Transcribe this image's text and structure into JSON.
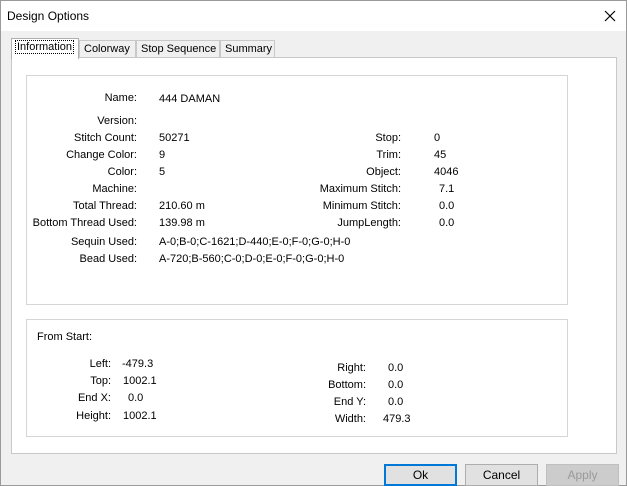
{
  "window": {
    "title": "Design Options"
  },
  "tabs": [
    {
      "label": "Information"
    },
    {
      "label": "Colorway"
    },
    {
      "label": "Stop Sequence"
    },
    {
      "label": "Summary"
    }
  ],
  "info": {
    "name_label": "Name:",
    "name_value": "444 DAMAN",
    "version_label": "Version:",
    "version_value": "",
    "stitch_count_label": "Stitch Count:",
    "stitch_count_value": "50271",
    "change_color_label": "Change Color:",
    "change_color_value": "9",
    "color_label": "Color:",
    "color_value": "5",
    "machine_label": "Machine:",
    "machine_value": "",
    "total_thread_label": "Total Thread:",
    "total_thread_value": "210.60 m",
    "bottom_thread_label": "Bottom Thread Used:",
    "bottom_thread_value": "139.98 m",
    "sequin_label": "Sequin Used:",
    "sequin_value": "A-0;B-0;C-1621;D-440;E-0;F-0;G-0;H-0",
    "bead_label": "Bead Used:",
    "bead_value": "A-720;B-560;C-0;D-0;E-0;F-0;G-0;H-0",
    "stop_label": "Stop:",
    "stop_value": "0",
    "trim_label": "Trim:",
    "trim_value": "45",
    "object_label": "Object:",
    "object_value": "4046",
    "max_stitch_label": "Maximum Stitch:",
    "max_stitch_value": "7.1",
    "min_stitch_label": "Minimum Stitch:",
    "min_stitch_value": "0.0",
    "jump_length_label": "JumpLength:",
    "jump_length_value": "0.0"
  },
  "from_start": {
    "heading": "From Start:",
    "left_label": "Left:",
    "left_value": "-479.3",
    "top_label": "Top:",
    "top_value": "1002.1",
    "endx_label": "End X:",
    "endx_value": "0.0",
    "height_label": "Height:",
    "height_value": "1002.1",
    "right_label": "Right:",
    "right_value": "0.0",
    "bottom_label": "Bottom:",
    "bottom_value": "0.0",
    "endy_label": "End Y:",
    "endy_value": "0.0",
    "width_label": "Width:",
    "width_value": "479.3"
  },
  "buttons": {
    "ok": "Ok",
    "cancel": "Cancel",
    "apply": "Apply"
  }
}
